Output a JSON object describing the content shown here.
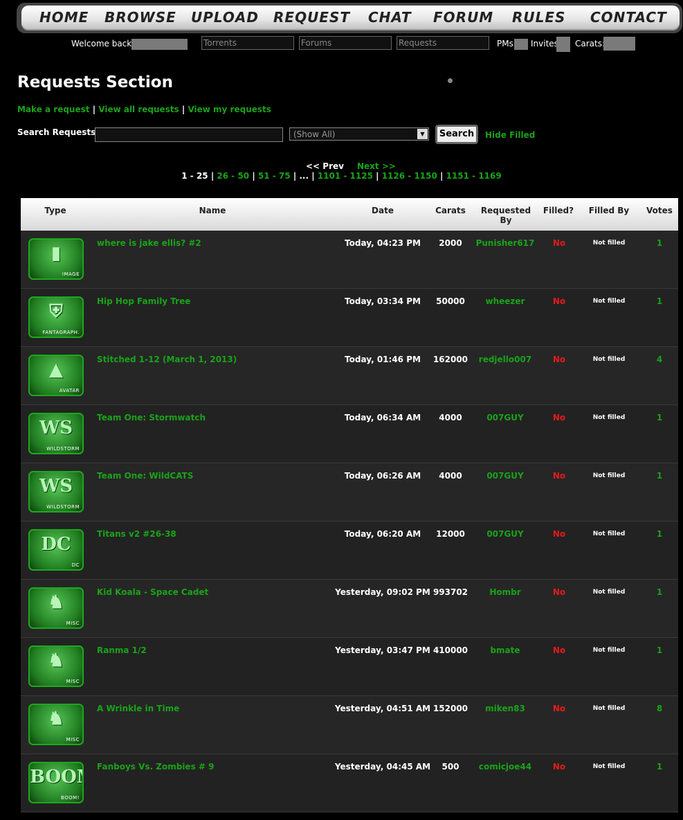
{
  "nav": {
    "items": [
      "HOME",
      "BROWSE",
      "UPLOAD",
      "REQUEST",
      "CHAT",
      "FORUM",
      "RULES",
      "CONTACT"
    ]
  },
  "userbar": {
    "welcome": "Welcome back,",
    "search_torrents_placeholder": "Torrents",
    "search_forums_placeholder": "Forums",
    "search_requests_placeholder": "Requests",
    "pms_label": "PMs:",
    "invites_label": "Invites",
    "carats_label": "Carats:"
  },
  "page": {
    "title": "Requests Section",
    "links": [
      "Make a request",
      "View all requests",
      "View my requests"
    ],
    "search_label": "Search Requests:",
    "filter_selected": "(Show All)",
    "search_button": "Search",
    "hide_filled": "Hide Filled"
  },
  "pager": {
    "prev": "<< Prev",
    "next": "Next >>",
    "current": "1 - 25",
    "pages": [
      "26 - 50",
      "51 - 75",
      "...",
      "1101 - 1125",
      "1126 - 1150",
      "1151 - 1169"
    ]
  },
  "table": {
    "headers": [
      "Type",
      "Name",
      "Date",
      "Carats",
      "Requested By",
      "Filled?",
      "Filled By",
      "Votes"
    ],
    "rows": [
      {
        "type": "IMAGE",
        "icon": "image-icon",
        "glyph": "▮",
        "name": "where is jake ellis? #2",
        "date": "Today, 04:23 PM",
        "carats": "2000",
        "by": "Punisher617",
        "filled": "No",
        "filled_by": "Not filled",
        "votes": "1"
      },
      {
        "type": "FANTAGRAPH.",
        "icon": "fantagraphics-icon",
        "glyph": "⛨",
        "name": "Hip Hop Family Tree",
        "date": "Today, 03:34 PM",
        "carats": "50000",
        "by": "wheezer",
        "filled": "No",
        "filled_by": "Not filled",
        "votes": "1"
      },
      {
        "type": "AVATAR",
        "icon": "avatar-icon",
        "glyph": "▲",
        "name": "Stitched 1-12 (March 1, 2013)",
        "date": "Today, 01:46 PM",
        "carats": "162000",
        "by": "redjello007",
        "filled": "No",
        "filled_by": "Not filled",
        "votes": "4"
      },
      {
        "type": "WILDSTORM",
        "icon": "wildstorm-icon",
        "glyph": "WS",
        "name": "Team One: Stormwatch",
        "date": "Today, 06:34 AM",
        "carats": "4000",
        "by": "007GUY",
        "filled": "No",
        "filled_by": "Not filled",
        "votes": "1"
      },
      {
        "type": "WILDSTORM",
        "icon": "wildstorm-icon",
        "glyph": "WS",
        "name": "Team One: WildCATS",
        "date": "Today, 06:26 AM",
        "carats": "4000",
        "by": "007GUY",
        "filled": "No",
        "filled_by": "Not filled",
        "votes": "1"
      },
      {
        "type": "DC",
        "icon": "dc-icon",
        "glyph": "DC",
        "name": "Titans v2 #26-38",
        "date": "Today, 06:20 AM",
        "carats": "12000",
        "by": "007GUY",
        "filled": "No",
        "filled_by": "Not filled",
        "votes": "1"
      },
      {
        "type": "MISC",
        "icon": "misc-donkey-icon",
        "glyph": "♞",
        "name": "Kid Koala - Space Cadet",
        "date": "Yesterday, 09:02 PM",
        "carats": "993702",
        "by": "Hombr",
        "filled": "No",
        "filled_by": "Not filled",
        "votes": "1"
      },
      {
        "type": "MISC",
        "icon": "misc-donkey-icon",
        "glyph": "♞",
        "name": "Ranma 1/2",
        "date": "Yesterday, 03:47 PM",
        "carats": "410000",
        "by": "bmate",
        "filled": "No",
        "filled_by": "Not filled",
        "votes": "1"
      },
      {
        "type": "MISC",
        "icon": "misc-donkey-icon",
        "glyph": "♞",
        "name": "A Wrinkle in Time",
        "date": "Yesterday, 04:51 AM",
        "carats": "152000",
        "by": "miken83",
        "filled": "No",
        "filled_by": "Not filled",
        "votes": "8"
      },
      {
        "type": "BOOM!",
        "icon": "boom-icon",
        "glyph": "BOOM!",
        "name": "Fanboys Vs. Zombies # 9",
        "date": "Yesterday, 04:45 AM",
        "carats": "500",
        "by": "comicjoe44",
        "filled": "No",
        "filled_by": "Not filled",
        "votes": "1"
      }
    ]
  }
}
